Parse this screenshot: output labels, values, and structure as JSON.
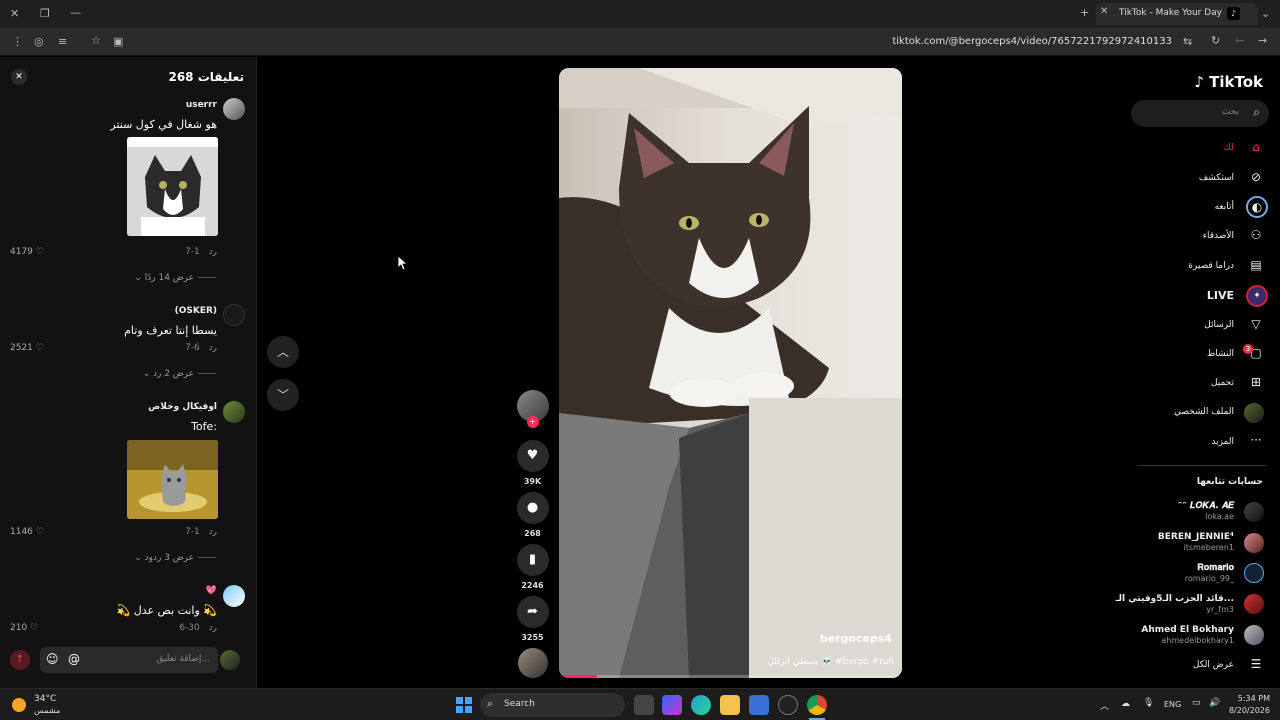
{
  "browser": {
    "tab_title": "TikTok - Make Your Day",
    "url": "tiktok.com/@bergoceps4/video/7657221792972410133"
  },
  "comments": {
    "header": "تعليقات 268",
    "items": [
      {
        "user": "userrr",
        "text": "هو شغال في كول سنتر",
        "date": "7-1",
        "reply": "رد",
        "likes": "4179",
        "view_replies": "عرض 14 ردًا",
        "has_image": true
      },
      {
        "user": "(OSKER)",
        "text": "يسطا إنتا تعرف وتام",
        "date": "7-6",
        "reply": "رد",
        "likes": "2521",
        "view_replies": "عرض 2 رد",
        "has_image": false
      },
      {
        "user": "اوفيكال وخلاص",
        "text": "Tofe:",
        "date": "7-1",
        "reply": "رد",
        "likes": "1146",
        "view_replies": "عرض 3 ردود",
        "has_image": true
      },
      {
        "user": "💖",
        "text": "💫 وانت بص عدل 💫",
        "date": "6-30",
        "reply": "رد",
        "likes": "210"
      }
    ],
    "composer_placeholder": "إضافة تعليق..."
  },
  "video": {
    "author": "bergoceps4",
    "caption": "يسطي انزللل 💀 #bergo #tufi",
    "progress": 0.11
  },
  "actions": {
    "likes": "39K",
    "comments": "268",
    "saves": "2246",
    "shares": "3255"
  },
  "sidebar": {
    "logo": "TikTok",
    "search_placeholder": "بحث",
    "nav": [
      {
        "label": "لك",
        "icon": "home-icon"
      },
      {
        "label": "استكشف",
        "icon": "compass-icon"
      },
      {
        "label": "أتابعه",
        "icon": "following-icon"
      },
      {
        "label": "الأصدقاء",
        "icon": "friends-icon"
      },
      {
        "label": "دراما قصيرة",
        "icon": "drama-icon"
      },
      {
        "label": "LIVE",
        "icon": "live-icon"
      },
      {
        "label": "الرسائل",
        "icon": "messages-icon"
      },
      {
        "label": "النشاط",
        "icon": "activity-icon",
        "badge": "3"
      },
      {
        "label": "تحميل",
        "icon": "upload-icon"
      },
      {
        "label": "الملف الشخصي",
        "icon": "profile-icon"
      },
      {
        "label": "المزيد",
        "icon": "more-icon"
      }
    ],
    "following_header": "حسابات تتابعها",
    "following": [
      {
        "name": "ᵔᵔ 𝑳𝑶𝑲𝑨. 𝑨𝑬",
        "handle": "loka.ae"
      },
      {
        "name": "BEREN_JENNIE⁴",
        "handle": "itsmeberen1"
      },
      {
        "name": "𝐑𝐨𝐦𝐚𝐫𝐢𝐨",
        "handle": "romario_99_"
      },
      {
        "name": "قائد الحزب الـ5وفيتي الـ...",
        "handle": "yr_fm3"
      },
      {
        "name": "Ahmed El Bokhary",
        "handle": "ahmedelbokhary1"
      }
    ],
    "see_all": "عرض الكل"
  },
  "taskbar": {
    "weather_temp": "34°C",
    "weather_desc": "مشمس",
    "search_label": "Search",
    "lang": "ENG",
    "time": "5:34 PM",
    "date": "8/20/2026"
  }
}
